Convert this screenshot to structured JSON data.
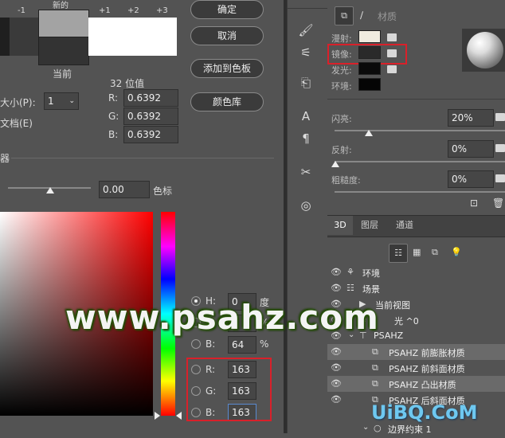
{
  "color_dialog": {
    "scale_labels": [
      "-1",
      "新的",
      "+1",
      "+2",
      "+3"
    ],
    "current_label": "当前",
    "buttons": {
      "ok": "确定",
      "cancel": "取消",
      "add_swatch": "添加到色板",
      "libraries": "颜色库"
    },
    "bits_label": "32 位值",
    "size_label": "大小(P):",
    "size_value": "1",
    "doc_label": "文档(E)",
    "rgb32": [
      {
        "label": "R:",
        "value": "0.6392"
      },
      {
        "label": "G:",
        "value": "0.6392"
      },
      {
        "label": "B:",
        "value": "0.6392"
      }
    ],
    "section_label": "器",
    "exposure_value": "0.00",
    "stops_label": "色标",
    "hsb": [
      {
        "label": "H:",
        "value": "0",
        "unit": "度",
        "selected": true
      },
      {
        "label": "S:",
        "value": "",
        "unit": "%",
        "selected": false
      },
      {
        "label": "B:",
        "value": "64",
        "unit": "%",
        "selected": false
      }
    ],
    "rgb": [
      {
        "label": "R:",
        "value": "163"
      },
      {
        "label": "G:",
        "value": "163"
      },
      {
        "label": "B:",
        "value": "163"
      }
    ],
    "colors": {
      "new": "#a3a3a3",
      "current": "#333333",
      "plus": "#ffffff",
      "red_box": "#d9202a"
    }
  },
  "properties": {
    "title": "材质",
    "materials": [
      {
        "label": "漫射:",
        "color": "#f0ece0"
      },
      {
        "label": "镜像:",
        "color": "#2a2a2a"
      },
      {
        "label": "发光:",
        "color": "#0a0a0a"
      },
      {
        "label": "环境:",
        "color": "#050505"
      }
    ],
    "sliders": [
      {
        "label": "闪亮:",
        "value": "20%",
        "level": 0.2
      },
      {
        "label": "反射:",
        "value": "0%",
        "level": 0
      },
      {
        "label": "粗糙度:",
        "value": "0%",
        "level": 0
      }
    ]
  },
  "panel_tabs": [
    "3D",
    "图层",
    "通道"
  ],
  "scene_items": [
    {
      "name": "环境",
      "icon": "environment-icon"
    },
    {
      "name": "场景",
      "icon": "scene-icon"
    },
    {
      "name": "当前视图",
      "icon": "camera-icon"
    },
    {
      "name": "光 ^0",
      "icon": "light-icon"
    },
    {
      "name": "PSAHZ",
      "icon": "mesh-icon"
    },
    {
      "name": "PSAHZ 前膨胀材质",
      "icon": "material-icon"
    },
    {
      "name": "PSAHZ 前斜面材质",
      "icon": "material-icon"
    },
    {
      "name": "PSAHZ 凸出材质",
      "icon": "material-icon"
    },
    {
      "name": "PSAHZ 后斜面材质",
      "icon": "material-icon"
    },
    {
      "name": "边界约束 1",
      "icon": "constraint-icon"
    }
  ],
  "watermarks": {
    "main": "www.psahz.com",
    "corner": "UiBQ.CoM"
  }
}
